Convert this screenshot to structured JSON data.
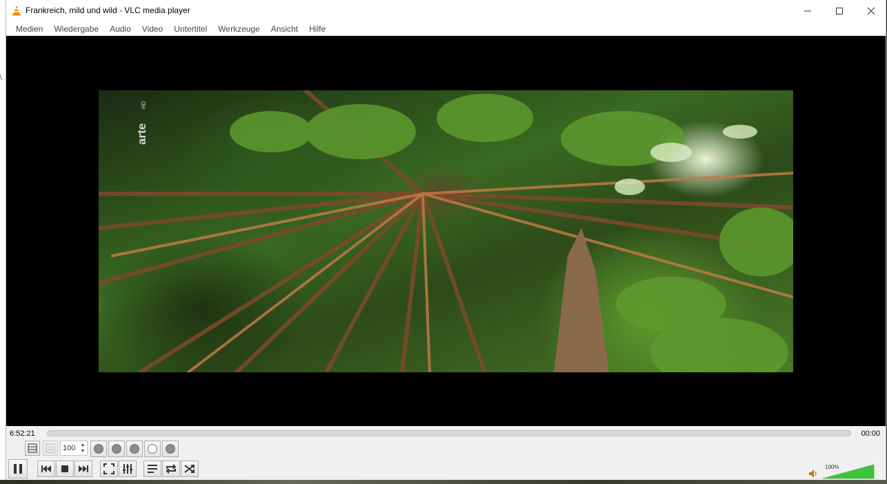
{
  "window": {
    "title": "Frankreich, mild und wild - VLC media player",
    "controls": {
      "minimize": "—",
      "maximize": "☐",
      "close": "✕"
    }
  },
  "menu": {
    "items": [
      "Medien",
      "Wiedergabe",
      "Audio",
      "Video",
      "Untertitel",
      "Werkzeuge",
      "Ansicht",
      "Hilfe"
    ]
  },
  "video": {
    "channel_logo": "arte HD"
  },
  "seek": {
    "elapsed": "6:52:21",
    "remaining": "00:00",
    "position": 0
  },
  "toolbar": {
    "zoom_value": "100",
    "volume_percent": "100%",
    "volume_level": 1.0
  },
  "colors": {
    "volume_fill": "#3cc43c",
    "video_bg": "#000000",
    "vlc_orange": "#f28c00"
  },
  "icons": {
    "app": "vlc-cone-icon",
    "pause": "pause-icon",
    "prev": "previous-icon",
    "stop": "stop-icon",
    "next": "next-icon",
    "fullscreen": "fullscreen-icon",
    "ext_settings": "equalizer-icon",
    "playlist": "playlist-icon",
    "loop": "loop-icon",
    "shuffle": "shuffle-icon",
    "speaker": "speaker-icon"
  }
}
